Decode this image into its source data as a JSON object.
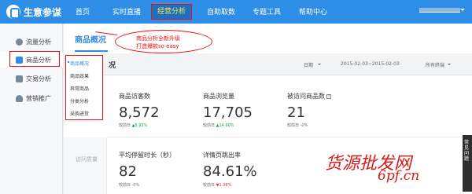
{
  "app": {
    "name": "生意参谋"
  },
  "nav": {
    "items": [
      {
        "label": "首页"
      },
      {
        "label": "实时直播"
      },
      {
        "label": "经营分析"
      },
      {
        "label": "自助取数"
      },
      {
        "label": "专题工具"
      },
      {
        "label": "帮助中心"
      }
    ],
    "active_index": 2
  },
  "sidebar": {
    "items": [
      {
        "label": "流量分析",
        "icon": "traffic-icon"
      },
      {
        "label": "商品分析",
        "icon": "product-icon"
      },
      {
        "label": "交易分析",
        "icon": "trade-icon"
      },
      {
        "label": "营销推广",
        "icon": "marketing-icon"
      }
    ],
    "active_index": 1
  },
  "dropdown": {
    "items": [
      {
        "label": "商品概况"
      },
      {
        "label": "商品效果"
      },
      {
        "label": "异常商品"
      },
      {
        "label": "分类分析"
      },
      {
        "label": "采购进货"
      }
    ]
  },
  "main": {
    "title": "商品概况",
    "header_title": "况",
    "date_label": "日期",
    "date_range": "2015-02-03~2015-02-03",
    "terminal": "所有终端",
    "section_tag": "访问质量"
  },
  "callout": {
    "line1": "商品分析全新升级",
    "line2": "打造爆款so easy"
  },
  "metrics": [
    {
      "label": "商品访客数",
      "value": "8,572",
      "cmp_label": "较前日",
      "cmp_value": "5.93%",
      "direction": "up",
      "arrow": "▲"
    },
    {
      "label": "商品浏览量",
      "value": "17,705",
      "cmp_label": "较前日",
      "cmp_value": "14.90%",
      "direction": "up",
      "arrow": "▲"
    },
    {
      "label": "被访问商品数",
      "value": "21",
      "cmp_label": "较前日",
      "cmp_value": "0%",
      "direction": "flat",
      "arrow": "-"
    },
    {
      "label": "平均停留时长（秒）",
      "value": "82",
      "cmp_label": "较前日",
      "cmp_value": "0%",
      "direction": "flat",
      "arrow": "-"
    },
    {
      "label": "详情页跳出率",
      "value": "84.61%",
      "cmp_label": "较前日",
      "cmp_value": "1.38%",
      "direction": "down",
      "arrow": "▼"
    }
  ],
  "watermark": {
    "line1": "货源批发网",
    "line2": "6pf.cn"
  },
  "side_tab": {
    "label": "常见问题"
  }
}
